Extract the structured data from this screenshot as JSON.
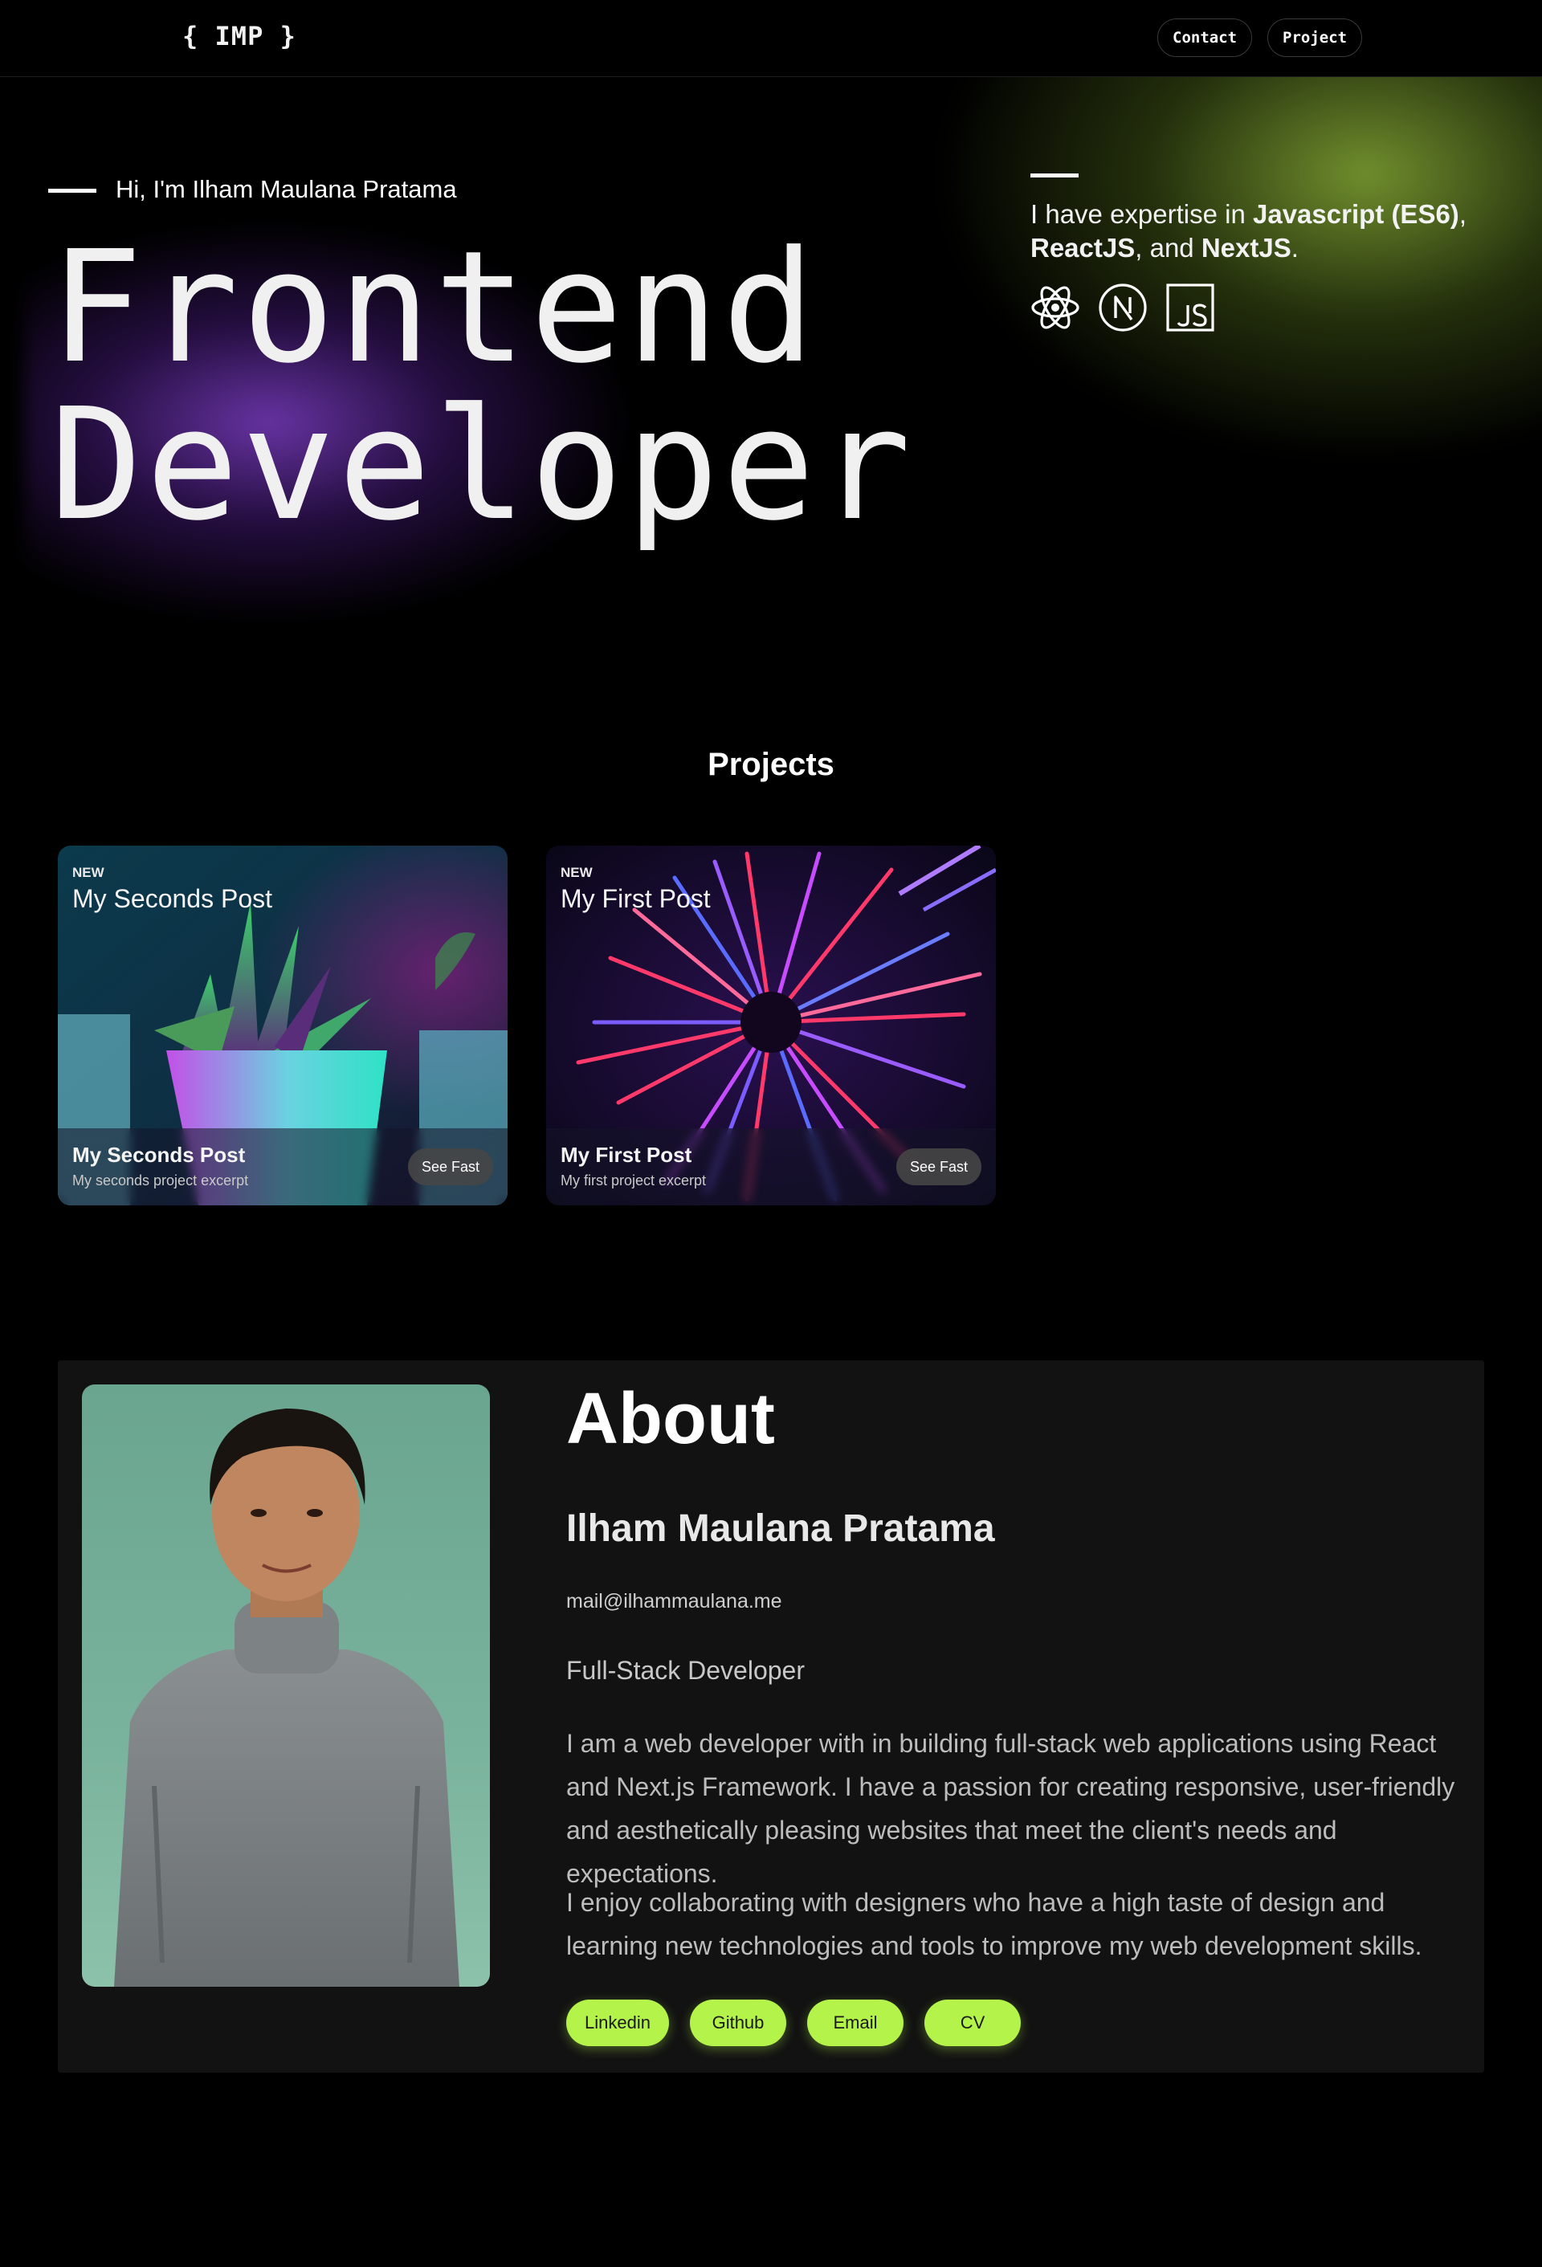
{
  "header": {
    "logo": "{ IMP }",
    "nav": {
      "contact": "Contact",
      "project": "Project"
    }
  },
  "hero": {
    "greeting": "Hi, I'm Ilham Maulana Pratama",
    "title_line1": "Frontend",
    "title_line2": "Developer",
    "expertise": {
      "prefix": "I have expertise in ",
      "skill1": "Javascript (ES6)",
      "sep1": ", ",
      "skill2": "ReactJS",
      "sep2": ", and ",
      "skill3": "NextJS",
      "suffix": "."
    },
    "icons": [
      "react-icon",
      "nextjs-icon",
      "javascript-icon"
    ]
  },
  "projects": {
    "title": "Projects",
    "cards": [
      {
        "badge": "NEW",
        "heading": "My Seconds Post",
        "title": "My Seconds Post",
        "excerpt": "My seconds project excerpt",
        "button": "See Fast"
      },
      {
        "badge": "NEW",
        "heading": "My First Post",
        "title": "My First Post",
        "excerpt": "My first project excerpt",
        "button": "See Fast"
      }
    ]
  },
  "about": {
    "title": "About",
    "name": "Ilham Maulana Pratama",
    "email": "mail@ilhammaulana.me",
    "role": "Full-Stack Developer",
    "paragraph1": "I am a web developer with in building full-stack web applications using React and Next.js Framework. I have a passion for creating responsive, user-friendly and aesthetically pleasing websites that meet the client's needs and expectations.",
    "paragraph2": "I enjoy collaborating with designers who have a high taste of design and learning new technologies and tools to improve my web development skills.",
    "links": {
      "linkedin": "Linkedin",
      "github": "Github",
      "email": "Email",
      "cv": "CV"
    }
  },
  "colors": {
    "background": "#000000",
    "accent": "#b4f34a",
    "card_bg": "#121212"
  }
}
